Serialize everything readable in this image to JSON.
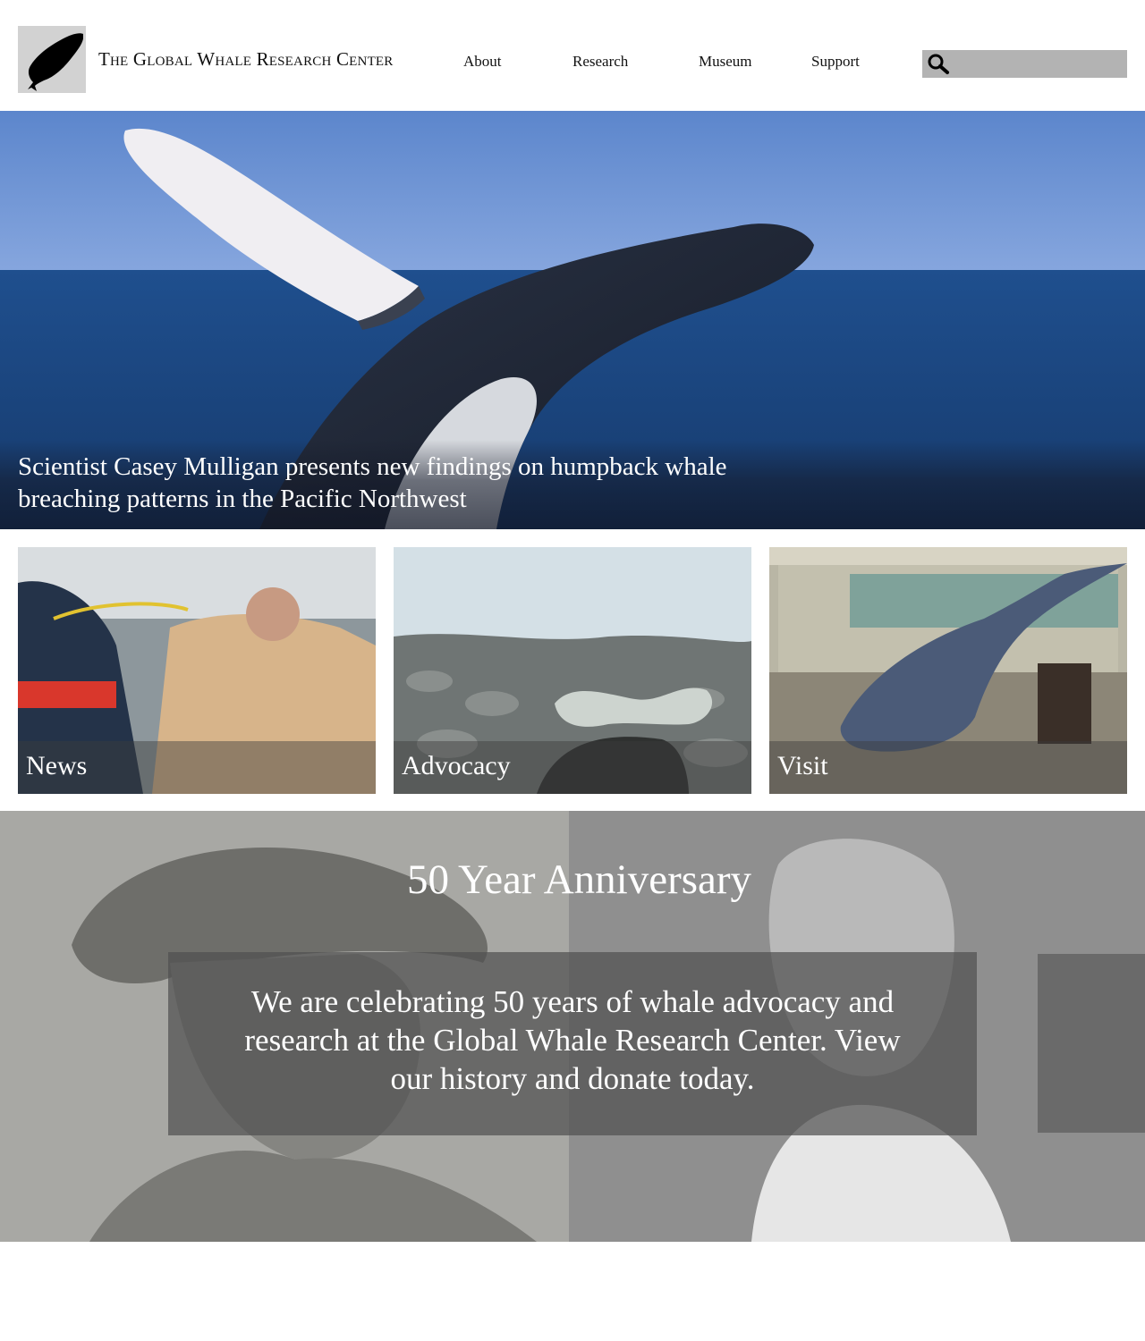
{
  "header": {
    "site_title": "The Global Whale Research Center",
    "logo_icon": "whale-logo-icon",
    "nav": [
      {
        "label": "About"
      },
      {
        "label": "Research"
      },
      {
        "label": "Museum"
      },
      {
        "label": "Support"
      }
    ],
    "search": {
      "placeholder": "",
      "value": "",
      "icon": "search-icon"
    }
  },
  "hero": {
    "caption": "Scientist Casey Mulligan presents new findings on humpback whale breaching patterns in the Pacific Northwest"
  },
  "cards": [
    {
      "label": "News"
    },
    {
      "label": "Advocacy"
    },
    {
      "label": "Visit"
    }
  ],
  "anniversary": {
    "title": "50 Year Anniversary",
    "body": "We are celebrating 50 years of whale advocacy and research at the Global Whale Research Center. View our history and donate today."
  },
  "colors": {
    "logo_bg": "#d2d2d2",
    "search_bg": "#b3b3b3",
    "anniversary_bg": "#a6a6a6",
    "text_dark": "#111111",
    "text_light": "#ffffff"
  }
}
